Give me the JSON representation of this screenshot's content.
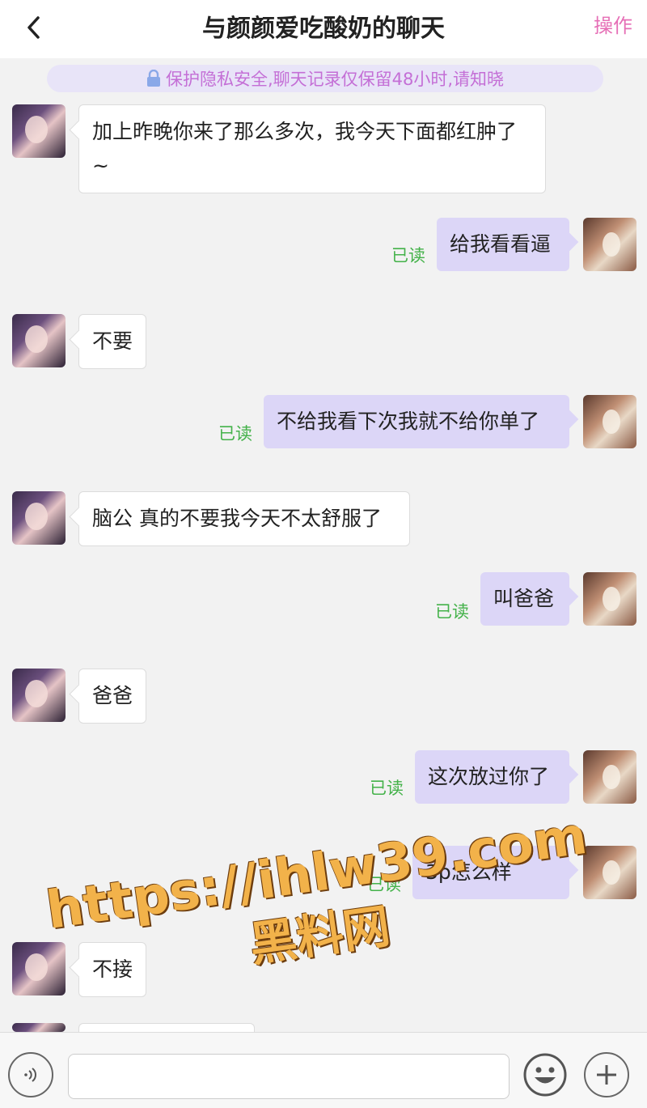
{
  "header": {
    "title": "与颜颜爱吃酸奶的聊天",
    "action_label": "操作"
  },
  "notice": {
    "text": "保护隐私安全,聊天记录仅保留48小时,请知晓"
  },
  "messages": [
    {
      "from": "her",
      "text": "加上昨晚你来了那么多次，我今天下面都红肿了~"
    },
    {
      "from": "me",
      "text": "给我看看逼",
      "status": "已读"
    },
    {
      "from": "her",
      "text": "不要"
    },
    {
      "from": "me",
      "text": "不给我看下次我就不给你单了",
      "status": "已读"
    },
    {
      "from": "her",
      "text": "脑公 真的不要我今天不太舒服了"
    },
    {
      "from": "me",
      "text": "叫爸爸",
      "status": "已读"
    },
    {
      "from": "her",
      "text": "爸爸"
    },
    {
      "from": "me",
      "text": "这次放过你了",
      "status": "已读"
    },
    {
      "from": "me",
      "text": "3p怎么样",
      "status": "已读"
    },
    {
      "from": "her",
      "text": "不接"
    }
  ],
  "watermark": {
    "line1": "https://ihlw39.com",
    "line2": "黑料网"
  },
  "input_bar": {
    "placeholder": ""
  },
  "icons": {
    "back": "chevron-left-icon",
    "lock": "lock-icon",
    "voice": "voice-icon",
    "emoji": "emoji-icon",
    "plus": "plus-icon"
  },
  "colors": {
    "accent": "#e66fb6",
    "notice_bg": "#e8e4f8",
    "notice_text": "#c46fd6",
    "my_bubble": "#dcd6f7",
    "read_status": "#44b24a"
  }
}
